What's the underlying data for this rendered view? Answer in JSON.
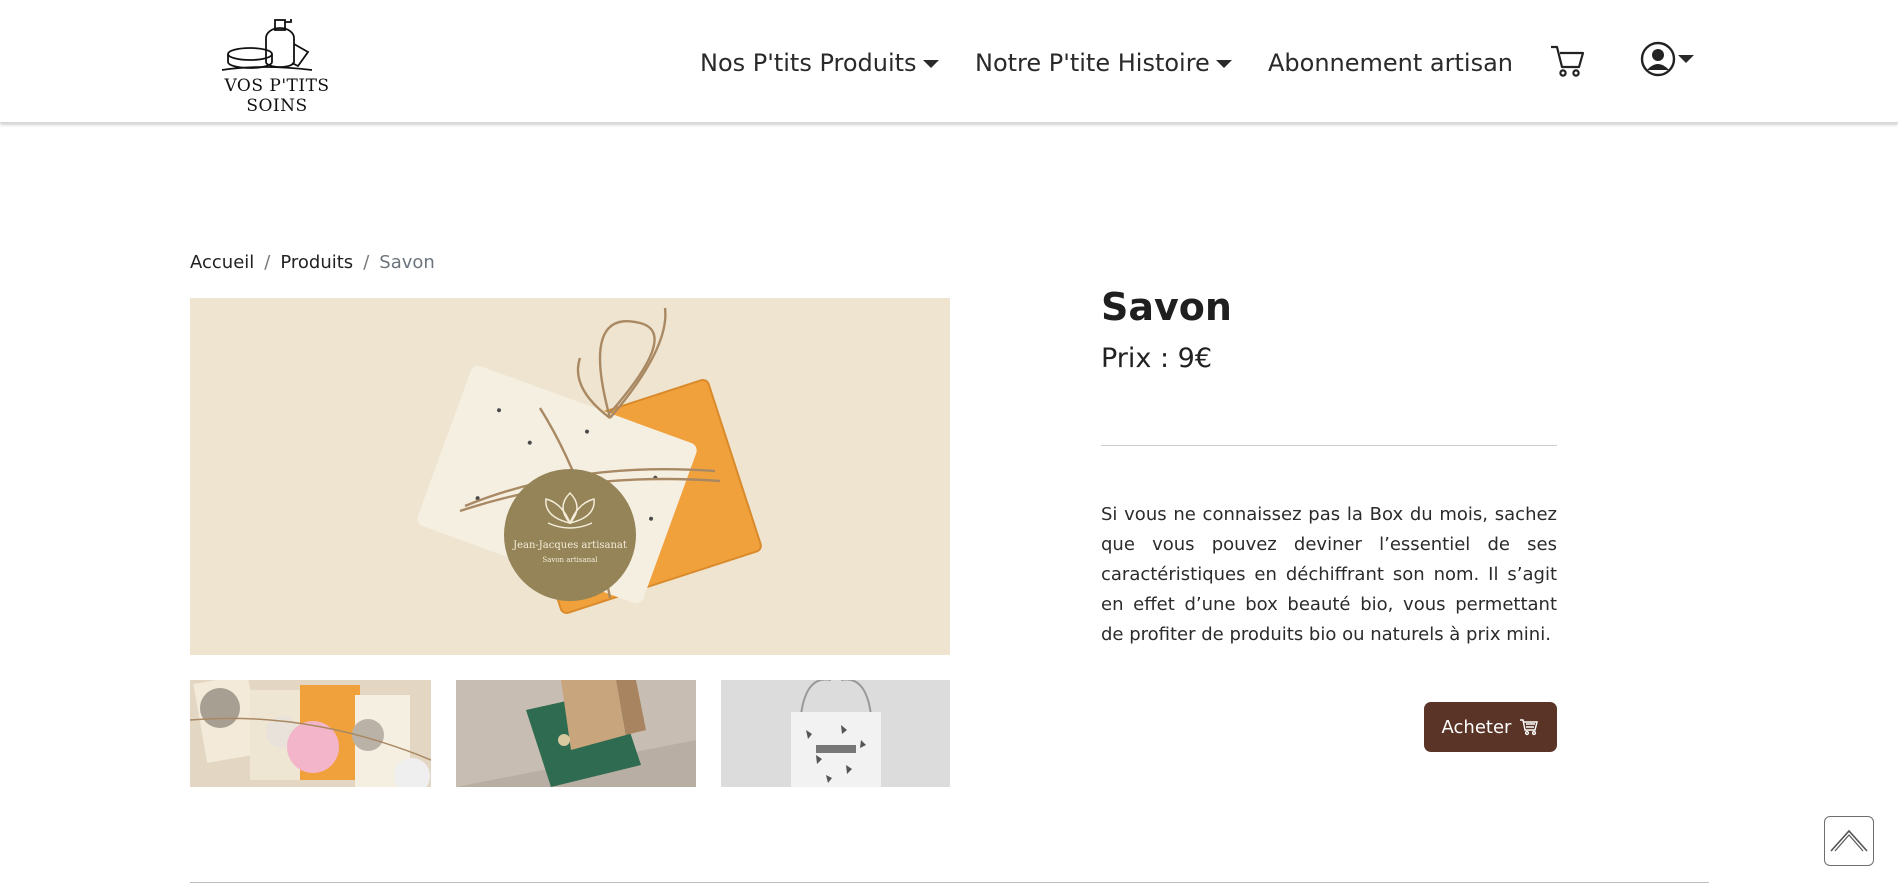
{
  "brand": {
    "name": "VOS P'TITS SOINS"
  },
  "nav": {
    "products": "Nos P'tits Produits",
    "history": "Notre P'tite Histoire",
    "subscription": "Abonnement artisan"
  },
  "icons": {
    "cart": "cart-icon",
    "user": "user-circle-icon",
    "scroll_top": "chevron-up-icon",
    "buy": "cart-icon"
  },
  "breadcrumb": {
    "home": "Accueil",
    "products": "Produits",
    "current": "Savon",
    "separator": "/"
  },
  "product": {
    "title": "Savon",
    "price": "Prix : 9€",
    "description": "Si vous ne connaissez pas la Box du mois, sachez que vous pouvez deviner l’essentiel de ses caractéristiques en déchiffrant son nom. Il s’agit en effet d’une box beauté bio, vous permettant de profiter de produits bio ou naturels à prix mini.",
    "buy_label": "Acheter",
    "tag_text_1": "Jean-Jacques artisanat",
    "tag_text_2": "Savon artisanal"
  },
  "colors": {
    "accent": "#5a3426",
    "tag": "#948458",
    "soap_orange": "#f1a13b",
    "background_beige": "#efe4cf"
  }
}
